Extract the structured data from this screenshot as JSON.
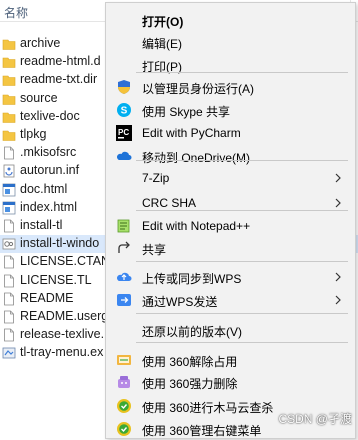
{
  "explorer": {
    "header_name": "名称",
    "files": [
      {
        "name": "archive",
        "type": "folder",
        "mark": ""
      },
      {
        "name": "readme-html.d",
        "type": "folder",
        "mark": ""
      },
      {
        "name": "readme-txt.dir",
        "type": "folder",
        "mark": ""
      },
      {
        "name": "source",
        "type": "folder",
        "mark": ""
      },
      {
        "name": "texlive-doc",
        "type": "folder",
        "mark": ""
      },
      {
        "name": "tlpkg",
        "type": "folder",
        "mark": ""
      },
      {
        "name": ".mkisofsrc",
        "type": "file",
        "mark": ""
      },
      {
        "name": "autorun.inf",
        "type": "inf",
        "mark": "2"
      },
      {
        "name": "doc.html",
        "type": "html",
        "mark": ""
      },
      {
        "name": "index.html",
        "type": "html",
        "mark": ""
      },
      {
        "name": "install-tl",
        "type": "file",
        "mark": ""
      },
      {
        "name": "install-tl-windo",
        "type": "batch",
        "mark": "4"
      },
      {
        "name": "LICENSE.CTAN",
        "type": "file",
        "mark": ""
      },
      {
        "name": "LICENSE.TL",
        "type": "file",
        "mark": ""
      },
      {
        "name": "README",
        "type": "file",
        "mark": ""
      },
      {
        "name": "README.userg",
        "type": "file",
        "mark": ""
      },
      {
        "name": "release-texlive.",
        "type": "file",
        "mark": ""
      },
      {
        "name": "tl-tray-menu.ex",
        "type": "exe",
        "mark": ""
      }
    ],
    "selected_index": 11
  },
  "context_menu": {
    "items": [
      {
        "label": "打开(O)",
        "bold": true,
        "icon": "none",
        "submenu": false
      },
      {
        "label": "编辑(E)",
        "bold": false,
        "icon": "none",
        "submenu": false
      },
      {
        "label": "打印(P)",
        "bold": false,
        "icon": "none",
        "submenu": false
      },
      {
        "label": "以管理员身份运行(A)",
        "bold": false,
        "icon": "uac-shield-icon",
        "submenu": false
      },
      {
        "label": "使用 Skype 共享",
        "bold": false,
        "icon": "skype-icon",
        "submenu": false
      },
      {
        "label": "Edit with PyCharm",
        "bold": false,
        "icon": "pycharm-icon",
        "submenu": false
      },
      {
        "label": "移动到 OneDrive(M)",
        "bold": false,
        "icon": "onedrive-icon",
        "submenu": false
      },
      {
        "label": "7-Zip",
        "bold": false,
        "icon": "none",
        "submenu": true
      },
      {
        "label": "CRC SHA",
        "bold": false,
        "icon": "none",
        "submenu": true
      },
      {
        "label": "Edit with Notepad++",
        "bold": false,
        "icon": "notepadpp-icon",
        "submenu": false
      },
      {
        "label": "共享",
        "bold": false,
        "icon": "share-icon",
        "submenu": false
      },
      {
        "label": "上传或同步到WPS",
        "bold": false,
        "icon": "wps-cloud-icon",
        "submenu": true
      },
      {
        "label": "通过WPS发送",
        "bold": false,
        "icon": "wps-send-icon",
        "submenu": true
      },
      {
        "label": "还原以前的版本(V)",
        "bold": false,
        "icon": "none",
        "submenu": false
      },
      {
        "label": "使用 360解除占用",
        "bold": false,
        "icon": "unlock-360-icon",
        "submenu": false
      },
      {
        "label": "使用 360强力删除",
        "bold": false,
        "icon": "delete-360-icon",
        "submenu": false
      },
      {
        "label": "使用 360进行木马云查杀",
        "bold": false,
        "icon": "scan-360-icon",
        "submenu": false
      },
      {
        "label": "使用 360管理右键菜单",
        "bold": false,
        "icon": "menu-360-icon",
        "submenu": false
      }
    ]
  },
  "watermark": "CSDN @孑渡",
  "colors": {
    "folder": "#f4c542",
    "selection": "#d9e8fb",
    "menu_bg": "#f2f2f2"
  }
}
